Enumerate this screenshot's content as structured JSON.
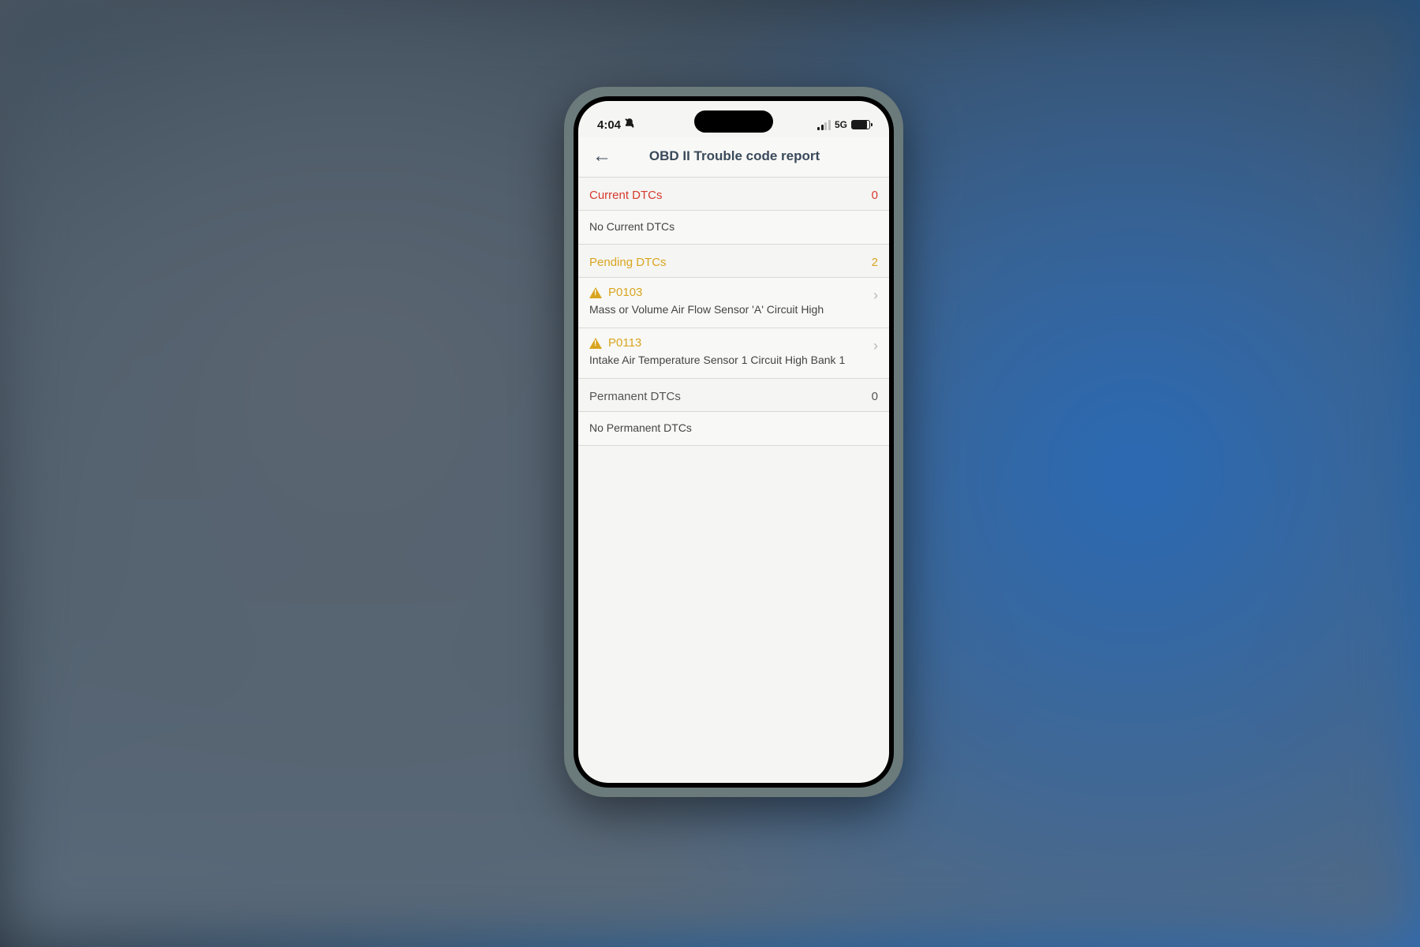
{
  "status_bar": {
    "time": "4:04",
    "dnd_icon": "dnd-bell-slash",
    "network": "5G"
  },
  "header": {
    "title": "OBD II Trouble code report"
  },
  "sections": {
    "current": {
      "label": "Current DTCs",
      "count": "0",
      "empty_msg": "No Current DTCs"
    },
    "pending": {
      "label": "Pending DTCs",
      "count": "2",
      "items": [
        {
          "code": "P0103",
          "description": "Mass or Volume Air Flow Sensor 'A' Circuit High"
        },
        {
          "code": "P0113",
          "description": "Intake Air Temperature Sensor 1 Circuit High Bank 1"
        }
      ]
    },
    "permanent": {
      "label": "Permanent DTCs",
      "count": "0",
      "empty_msg": "No Permanent DTCs"
    }
  }
}
